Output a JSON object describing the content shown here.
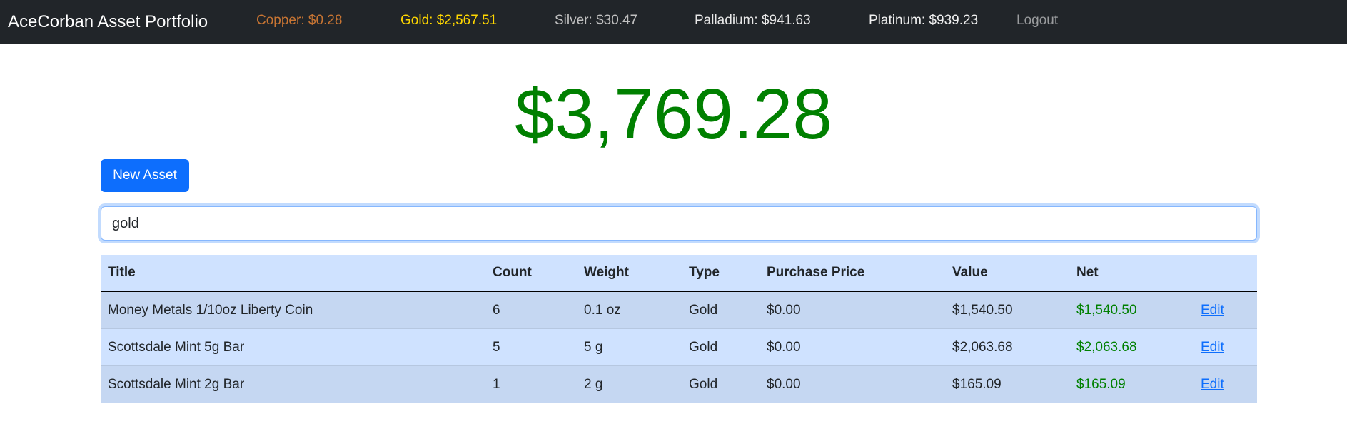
{
  "nav": {
    "brand": "AceCorban Asset Portfolio",
    "copper": "Copper: $0.28",
    "gold": "Gold: $2,567.51",
    "silver": "Silver: $30.47",
    "palladium": "Palladium: $941.63",
    "platinum": "Platinum: $939.23",
    "logout": "Logout"
  },
  "total": "$3,769.28",
  "new_asset_label": "New Asset",
  "search": {
    "value": "gold"
  },
  "table": {
    "headers": [
      "Title",
      "Count",
      "Weight",
      "Type",
      "Purchase Price",
      "Value",
      "Net",
      ""
    ],
    "rows": [
      {
        "title": "Money Metals 1/10oz Liberty Coin",
        "count": "6",
        "weight": "0.1 oz",
        "type": "Gold",
        "purchase_price": "$0.00",
        "value": "$1,540.50",
        "net": "$1,540.50",
        "edit": "Edit"
      },
      {
        "title": "Scottsdale Mint 5g Bar",
        "count": "5",
        "weight": "5 g",
        "type": "Gold",
        "purchase_price": "$0.00",
        "value": "$2,063.68",
        "net": "$2,063.68",
        "edit": "Edit"
      },
      {
        "title": "Scottsdale Mint 2g Bar",
        "count": "1",
        "weight": "2 g",
        "type": "Gold",
        "purchase_price": "$0.00",
        "value": "$165.09",
        "net": "$165.09",
        "edit": "Edit"
      }
    ]
  },
  "colors": {
    "net_positive": "#008000",
    "accent": "#0d6efd",
    "navbar": "#212529"
  }
}
